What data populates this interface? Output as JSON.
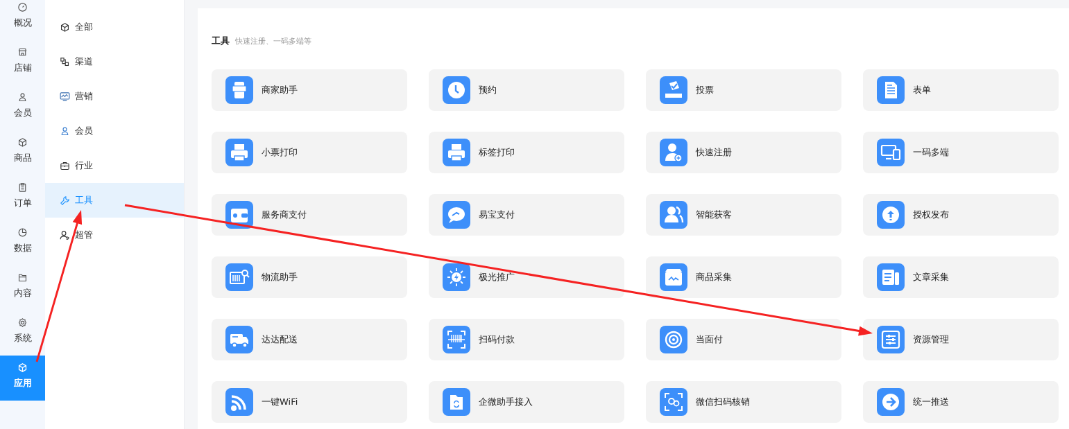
{
  "main_nav": [
    {
      "label": "概况",
      "selected": false
    },
    {
      "label": "店铺",
      "selected": false
    },
    {
      "label": "会员",
      "selected": false
    },
    {
      "label": "商品",
      "selected": false
    },
    {
      "label": "订单",
      "selected": false
    },
    {
      "label": "数据",
      "selected": false
    },
    {
      "label": "内容",
      "selected": false
    },
    {
      "label": "系统",
      "selected": false
    },
    {
      "label": "应用",
      "selected": true
    }
  ],
  "sub_nav": [
    {
      "label": "全部",
      "selected": false
    },
    {
      "label": "渠道",
      "selected": false
    },
    {
      "label": "营销",
      "selected": false
    },
    {
      "label": "会员",
      "selected": false
    },
    {
      "label": "行业",
      "selected": false
    },
    {
      "label": "工具",
      "selected": true
    },
    {
      "label": "超管",
      "selected": false
    }
  ],
  "section": {
    "title": "工具",
    "subtitle": "快速注册、一码多端等"
  },
  "tools": [
    "商家助手",
    "预约",
    "投票",
    "表单",
    "小票打印",
    "标签打印",
    "快速注册",
    "一码多端",
    "服务商支付",
    "易宝支付",
    "智能获客",
    "授权发布",
    "物流助手",
    "极光推广",
    "商品采集",
    "文章采集",
    "达达配送",
    "扫码付款",
    "当面付",
    "资源管理",
    "一键WiFi",
    "企微助手接入",
    "微信扫码核销",
    "统一推送"
  ]
}
